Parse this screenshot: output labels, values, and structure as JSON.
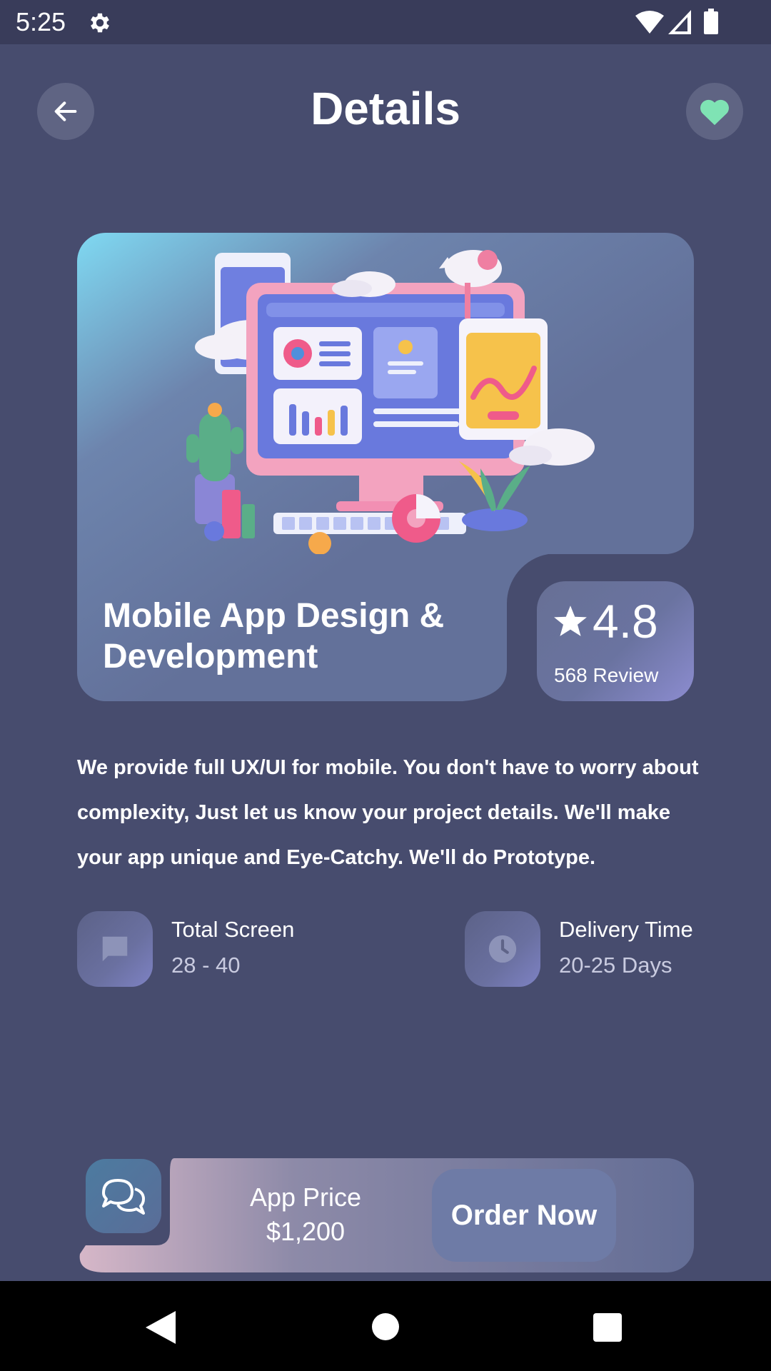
{
  "status_bar": {
    "time": "5:25",
    "icons": [
      "gear-icon",
      "wifi-icon",
      "signal-icon",
      "battery-icon"
    ]
  },
  "header": {
    "title": "Details",
    "back_icon": "arrow-left-icon",
    "favorite_icon": "heart-icon"
  },
  "hero": {
    "title": "Mobile App Design & Development",
    "illustration": "3d-desktop-illustration",
    "rating": {
      "icon": "star-icon",
      "value": "4.8",
      "reviews": "568 Review"
    }
  },
  "description": "We provide full UX/UI for mobile. You don't have to worry about complexity, Just let us know your project details. We'll make your app unique and Eye-Catchy. We'll do Prototype.",
  "info": [
    {
      "icon": "chat-bubble-icon",
      "label": "Total Screen",
      "value": "28 - 40"
    },
    {
      "icon": "clock-icon",
      "label": "Delivery Time",
      "value": "20-25 Days"
    }
  ],
  "bottom_bar": {
    "chat_icon": "chat-icon",
    "price_label": "App Price",
    "price_value": "$1,200",
    "order_label": "Order Now"
  },
  "colors": {
    "background": "#474c6e",
    "status_bar": "#393c5a",
    "favorite_heart": "#7fe3b4",
    "order_button": "#6e7ba6"
  },
  "nav": [
    "back-nav-icon",
    "home-nav-icon",
    "recents-nav-icon"
  ]
}
